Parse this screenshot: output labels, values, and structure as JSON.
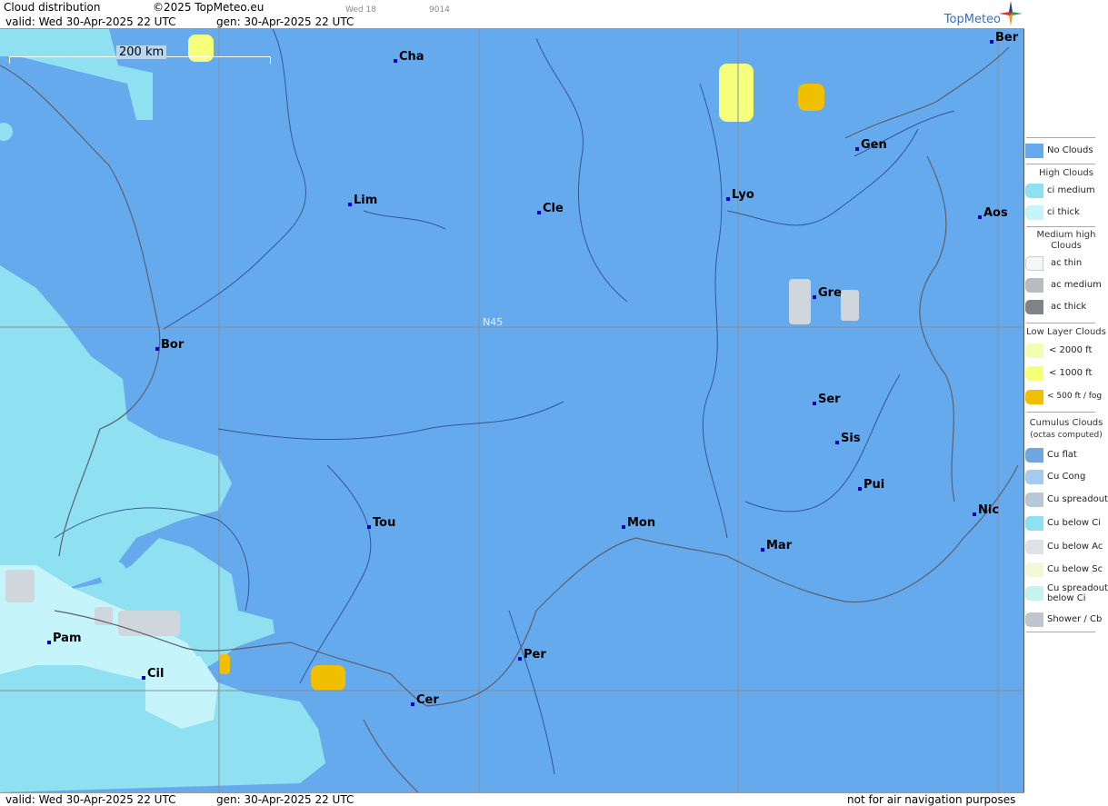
{
  "header": {
    "title": "Cloud distribution",
    "copyright": "©2025 TopMeteo.eu",
    "time_code": "Wed 18",
    "code": "9014",
    "valid_line": "valid:  Wed  30-Apr-2025  22 UTC",
    "gen_line": "gen: 30-Apr-2025 22 UTC",
    "brand": "TopMeteo"
  },
  "map": {
    "scale_label": "200 km",
    "latitude_label": "N45",
    "cities": [
      {
        "name": "Cha"
      },
      {
        "name": "Ber"
      },
      {
        "name": "Gen"
      },
      {
        "name": "Lim"
      },
      {
        "name": "Cle"
      },
      {
        "name": "Lyo"
      },
      {
        "name": "Aos"
      },
      {
        "name": "Gre"
      },
      {
        "name": "Bor"
      },
      {
        "name": "Ser"
      },
      {
        "name": "Sis"
      },
      {
        "name": "Pui"
      },
      {
        "name": "Tou"
      },
      {
        "name": "Mon"
      },
      {
        "name": "Mar"
      },
      {
        "name": "Nic"
      },
      {
        "name": "Pam"
      },
      {
        "name": "Cil"
      },
      {
        "name": "Per"
      },
      {
        "name": "Cer"
      }
    ],
    "colors": {
      "no_clouds": "#66aaee",
      "ci_medium": "#8fe0f0",
      "ci_thick": "#c5f4fb",
      "low_2000": "#f0ffb0",
      "low_1000": "#f5ff7a",
      "low_500": "#f0c000"
    }
  },
  "footer": {
    "valid_line": "valid:  Wed  30-Apr-2025  22 UTC",
    "gen_line": "gen: 30-Apr-2025 22 UTC",
    "disclaimer": "not for air navigation purposes"
  },
  "legend": {
    "no_clouds": "No Clouds",
    "high_title": "High Clouds",
    "ci_medium": "ci medium",
    "ci_thick": "ci thick",
    "medium_title": "Medium high Clouds",
    "ac_thin": "ac thin",
    "ac_medium": "ac medium",
    "ac_thick": "ac thick",
    "low_title": "Low Layer Clouds",
    "low_2000": "< 2000 ft",
    "low_1000": "< 1000 ft",
    "low_500": "< 500 ft / fog",
    "cu_title": "Cumulus Clouds",
    "cu_subtitle": "(octas computed)",
    "cu_flat": "Cu flat",
    "cu_cong": "Cu Cong",
    "cu_spreadout": "Cu spreadout",
    "cu_below_ci": "Cu below Ci",
    "cu_below_ac": "Cu below Ac",
    "cu_below_sc": "Cu below Sc",
    "cu_spreadout_below_ci_1": "Cu spreadout",
    "cu_spreadout_below_ci_2": "below Ci",
    "shower": "Shower / Cb"
  }
}
